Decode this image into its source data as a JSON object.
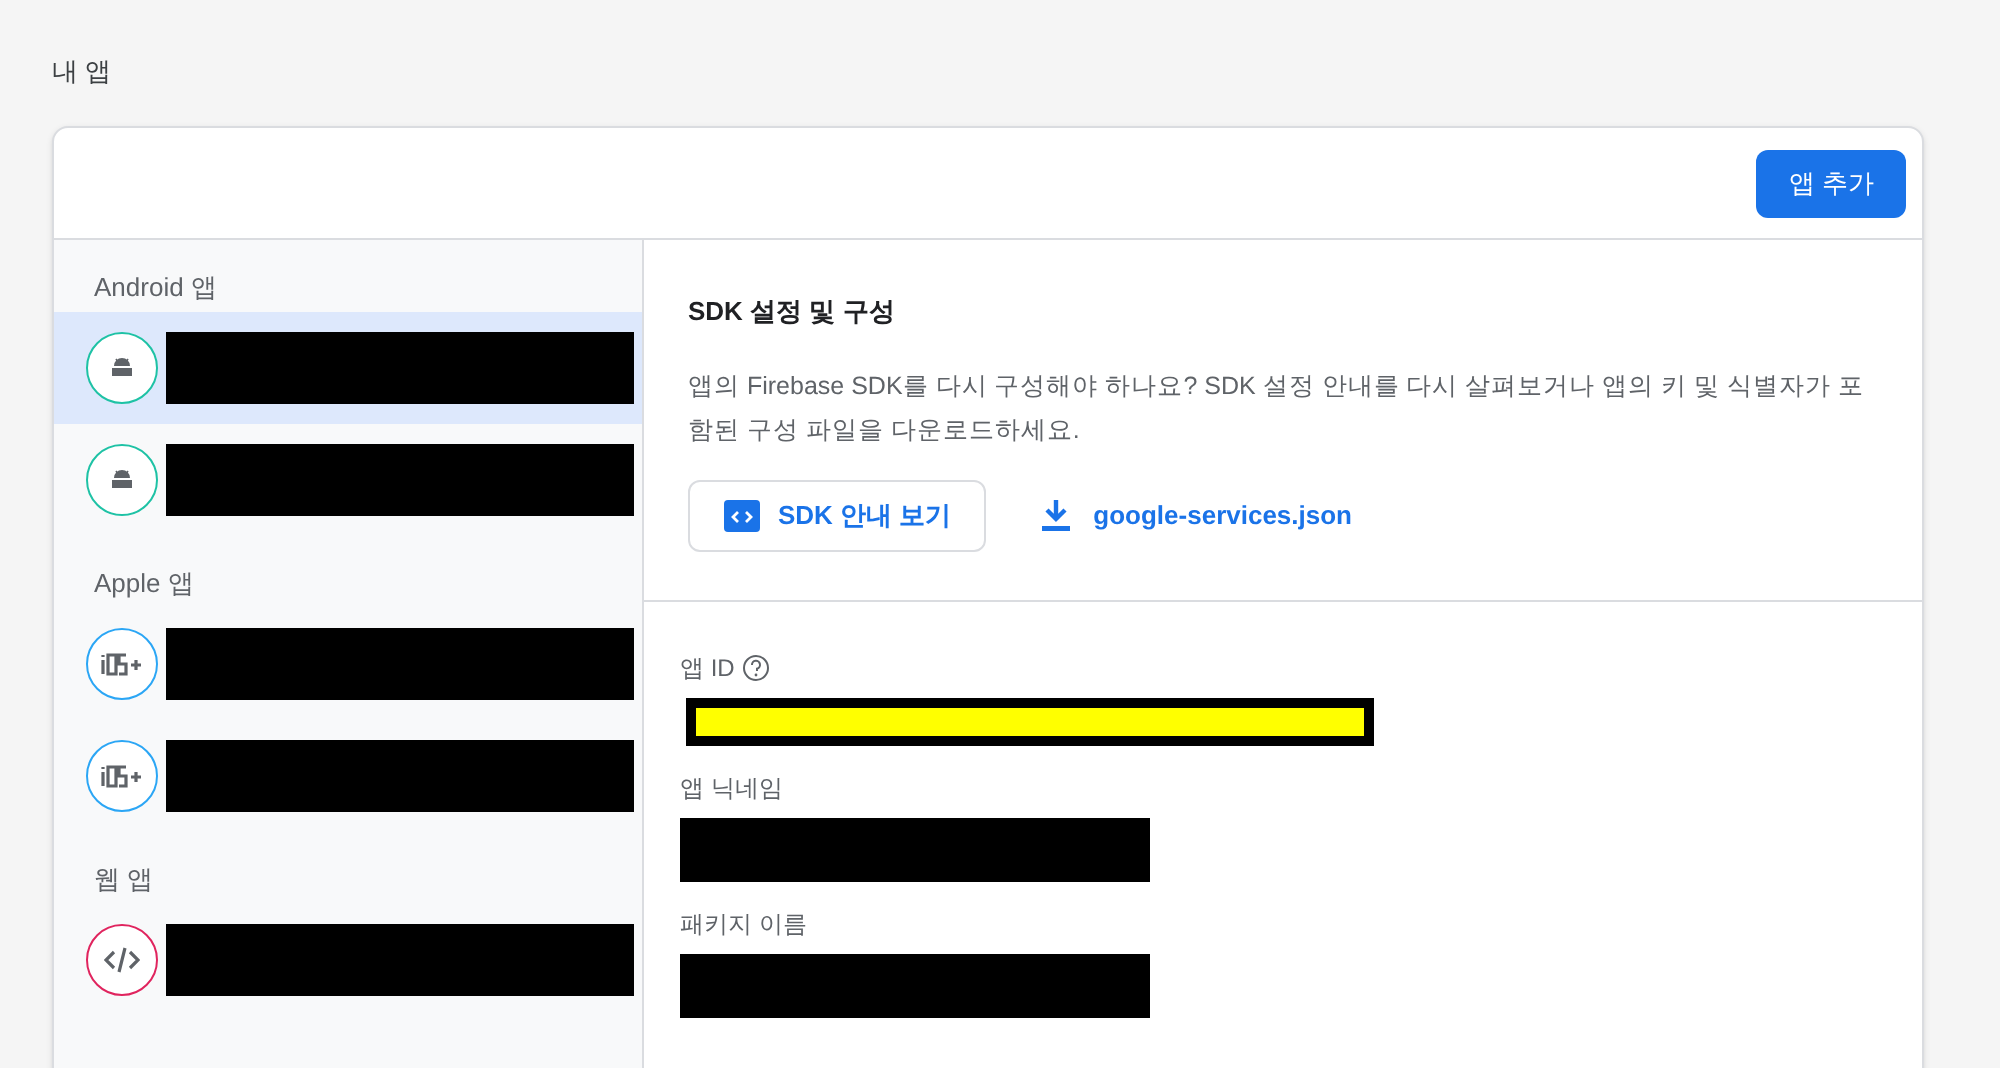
{
  "page_title": "내 앱",
  "add_button": "앱 추가",
  "app_groups": [
    {
      "label": "Android 앱",
      "apps": [
        {
          "kind": "android",
          "selected": true,
          "name_redacted": true
        },
        {
          "kind": "android",
          "selected": false,
          "name_redacted": true
        }
      ]
    },
    {
      "label": "Apple 앱",
      "apps": [
        {
          "kind": "ios",
          "selected": false,
          "name_redacted": true
        },
        {
          "kind": "ios",
          "selected": false,
          "name_redacted": true
        }
      ]
    },
    {
      "label": "웹 앱",
      "apps": [
        {
          "kind": "web",
          "selected": false,
          "name_redacted": true
        }
      ]
    }
  ],
  "sdk_section": {
    "title": "SDK 설정 및 구성",
    "description": "앱의 Firebase SDK를 다시 구성해야 하나요? SDK 설정 안내를 다시 살펴보거나 앱의 키 및 식별자가 포함된 구성 파일을 다운로드하세요.",
    "guide_button": "SDK 안내 보기",
    "download_link": "google-services.json"
  },
  "fields": [
    {
      "label": "앱 ID",
      "help": true,
      "highlighted": true
    },
    {
      "label": "앱 닉네임",
      "highlighted": false
    },
    {
      "label": "패키지 이름",
      "highlighted": false
    }
  ]
}
